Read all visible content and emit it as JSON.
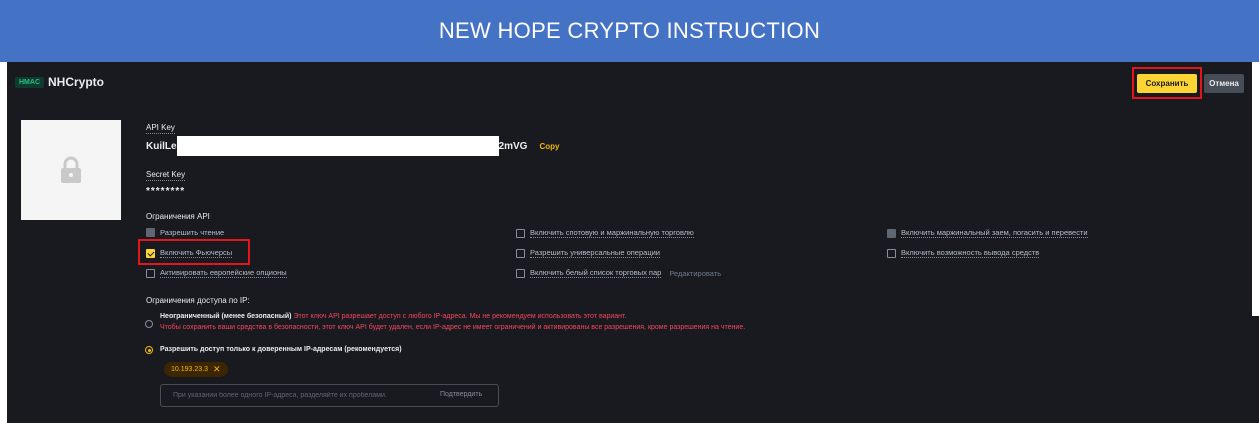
{
  "banner": {
    "title": "NEW HOPE CRYPTO INSTRUCTION"
  },
  "header": {
    "badge": "HMAC",
    "key_name": "NHCrypto",
    "save_label": "Сохранить",
    "cancel_label": "Отмена"
  },
  "api_key": {
    "label": "API Key",
    "value_prefix": "KuilLe",
    "value_suffix": "2mVG",
    "copy_label": "Copy"
  },
  "secret_key": {
    "label": "Secret Key",
    "value": "********"
  },
  "restrictions": {
    "title": "Ограничения API",
    "items": [
      {
        "label": "Разрешить чтение",
        "state": "disabled-checked"
      },
      {
        "label": "Включить спотовую и маржинальную торговлю",
        "state": "unchecked"
      },
      {
        "label": "Включить маржинальный заем, погасить и перевести",
        "state": "disabled"
      },
      {
        "label": "Включить Фьючерсы",
        "state": "checked"
      },
      {
        "label": "Разрешить универсальные операции",
        "state": "unchecked"
      },
      {
        "label": "Включить возможность вывода средств",
        "state": "unchecked"
      },
      {
        "label": "Активировать европейские опционы",
        "state": "unchecked"
      },
      {
        "label": "Включить белый список торговых пар",
        "state": "unchecked"
      }
    ],
    "edit_label": "Редактировать"
  },
  "ip_access": {
    "title": "Ограничения доступа по IP:",
    "unrestricted": {
      "label": "Неограниченный (менее безопасный)",
      "warning_line1": "Этот ключ API разрешает доступ с любого IP-адреса. Мы не рекомендуем использовать этот вариант.",
      "warning_line2": "Чтобы сохранить ваши средства в безопасности, этот ключ API будет удален, если IP-адрес не имеет ограничений и активированы все разрешения, кроме разрешения на чтение.",
      "selected": false
    },
    "trusted": {
      "label": "Разрешить доступ только к доверенным IP-адресам (рекомендуется)",
      "selected": true
    },
    "ip_tag": "10.193.23.3",
    "input_placeholder": "При указании более одного IP-адреса, разделяйте их пробелами.",
    "confirm_label": "Подтвердить"
  },
  "colors": {
    "banner": "#4472c4",
    "panel": "#181a20",
    "accent": "#fcd535",
    "warning": "#f6465d",
    "highlight_box": "#e3161b"
  }
}
